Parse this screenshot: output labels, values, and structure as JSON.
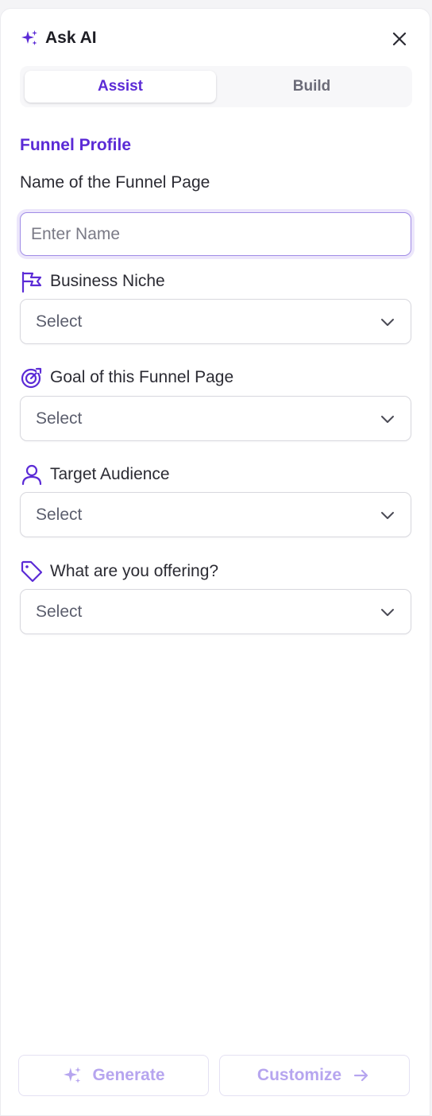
{
  "header": {
    "title": "Ask AI",
    "icon": "sparkles-icon"
  },
  "tabs": [
    {
      "label": "Assist",
      "active": true
    },
    {
      "label": "Build",
      "active": false
    }
  ],
  "section_title": "Funnel Profile",
  "fields": {
    "name": {
      "label": "Name of the Funnel Page",
      "placeholder": "Enter Name",
      "value": ""
    },
    "niche": {
      "label": "Business Niche",
      "value": "Select",
      "icon": "flag-icon"
    },
    "goal": {
      "label": "Goal of this Funnel Page",
      "value": "Select",
      "icon": "target-icon"
    },
    "audience": {
      "label": "Target Audience",
      "value": "Select",
      "icon": "user-icon"
    },
    "offering": {
      "label": "What are you offering?",
      "value": "Select",
      "icon": "tag-icon"
    }
  },
  "footer": {
    "generate_label": "Generate",
    "customize_label": "Customize"
  },
  "colors": {
    "accent": "#5b2bd6",
    "disabled_accent": "#b6a5ef"
  }
}
